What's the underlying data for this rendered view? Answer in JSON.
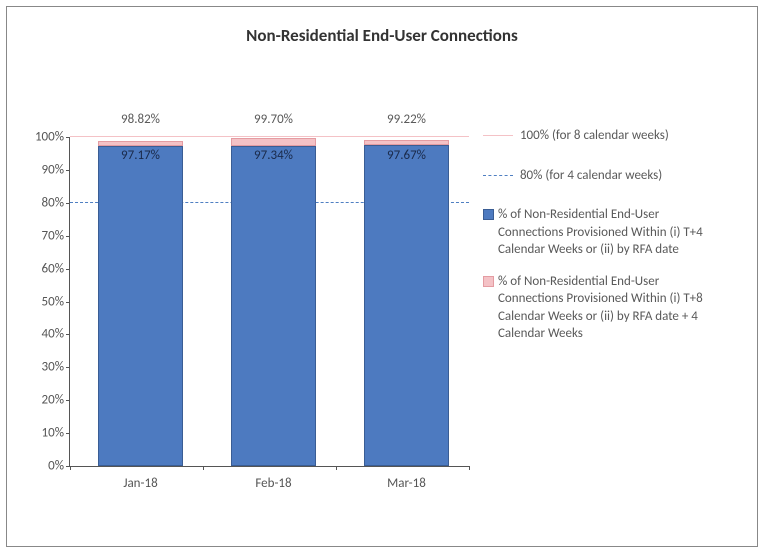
{
  "title": "Non-Residential End-User Connections",
  "chart_data": {
    "type": "bar",
    "categories": [
      "Jan-18",
      "Feb-18",
      "Mar-18"
    ],
    "series": [
      {
        "name": "% of Non-Residential End-User Connections Provisioned Within (i) T+4 Calendar Weeks or (ii) by RFA date",
        "values": [
          97.17,
          97.34,
          97.67
        ],
        "color": "#4d7ac0"
      },
      {
        "name": "% of Non-Residential End-User Connections Provisioned Within (i) T+8 Calendar Weeks or (ii) by RFA date + 4 Calendar Weeks",
        "values": [
          98.82,
          99.7,
          99.22
        ],
        "color": "#f4c2c6"
      }
    ],
    "yticks": [
      "0%",
      "10%",
      "20%",
      "30%",
      "40%",
      "50%",
      "60%",
      "70%",
      "80%",
      "90%",
      "100%"
    ],
    "ylim": [
      0,
      100
    ],
    "reference_lines": [
      {
        "at": 100,
        "label": "100% (for 8 calendar weeks)"
      },
      {
        "at": 80,
        "label": "80% (for 4 calendar weeks)"
      }
    ]
  },
  "labels": {
    "top0": "98.82%",
    "top1": "99.70%",
    "top2": "99.22%",
    "inner0": "97.17%",
    "inner1": "97.34%",
    "inner2": "97.67%"
  },
  "legend": {
    "l100": "100% (for 8 calendar weeks)",
    "l80": "80% (for 4 calendar weeks)",
    "sBlue": "% of Non-Residential End-User Connections Provisioned Within (i) T+4 Calendar Weeks or (ii) by RFA date",
    "sPink": "% of Non-Residential End-User Connections Provisioned Within (i) T+8 Calendar Weeks or (ii) by RFA date + 4 Calendar Weeks"
  }
}
